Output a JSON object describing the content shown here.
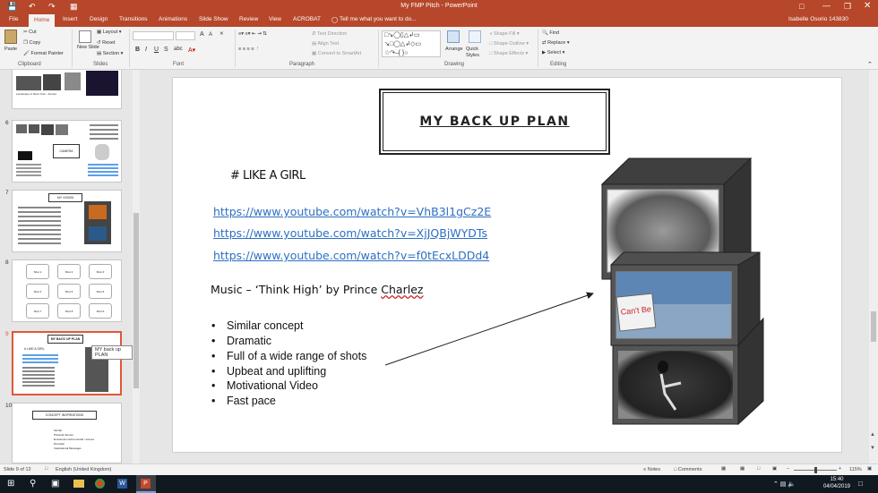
{
  "window": {
    "title": "My FMP Pitch - PowerPoint",
    "user": "Isabelle Osorio 143830"
  },
  "tabs": [
    "File",
    "Home",
    "Insert",
    "Design",
    "Transitions",
    "Animations",
    "Slide Show",
    "Review",
    "View",
    "ACROBAT"
  ],
  "tell_me": "Tell me what you want to do...",
  "ribbon": {
    "clipboard": {
      "group": "Clipboard",
      "paste": "Paste",
      "cut": "Cut",
      "copy": "Copy",
      "format_painter": "Format Painter"
    },
    "slides": {
      "group": "Slides",
      "new_slide": "New Slide",
      "layout": "Layout",
      "reset": "Reset",
      "section": "Section"
    },
    "font": {
      "group": "Font",
      "bold": "B",
      "italic": "I",
      "underline": "U",
      "strike": "S",
      "shadow": "abc",
      "grow": "A",
      "shrink": "A"
    },
    "paragraph": {
      "group": "Paragraph",
      "text_direction": "Text Direction",
      "align_text": "Align Text",
      "smartart": "Convert to SmartArt"
    },
    "drawing": {
      "group": "Drawing",
      "arrange": "Arrange",
      "quick_styles": "Quick Styles",
      "shape_fill": "Shape Fill",
      "shape_outline": "Shape Outline",
      "shape_effects": "Shape Effects"
    },
    "editing": {
      "group": "Editing",
      "find": "Find",
      "replace": "Replace",
      "select": "Select"
    }
  },
  "thumbnails": {
    "numbers": [
      "6",
      "7",
      "8",
      "9",
      "10"
    ],
    "t5_caption": "Landscape of Moon Kiss - Sunset",
    "t6_box": "CAMERA",
    "t7_box": "MY VISION",
    "t8_cells": [
      "Shot 1",
      "Shot 2",
      "Shot 3",
      "Shot 4",
      "Shot 5",
      "Shot 6",
      "Shot 7",
      "Shot 8",
      "Shot 9"
    ],
    "t9_title": "MY BACK UP PLAN",
    "t9_text": "# LIKE A GIRL",
    "t10_title": "CONCEPT INSPIRATIONS",
    "t10_bullets": [
      "Similar",
      "Physical themes",
      "Emotional environmental / scenes",
      "Dramatic",
      "Inspirational Messages"
    ],
    "tooltip": "MY back up PLAN"
  },
  "slide": {
    "title": "MY BACK UP PLAN",
    "hashtag": "# LIKE A GIRL",
    "links": [
      "https://www.youtube.com/watch?v=VhB3l1gCz2E",
      "https://www.youtube.com/watch?v=XjJQBjWYDTs",
      "https://www.youtube.com/watch?v=f0tEcxLDDd4"
    ],
    "music": "Music – ‘Think High’ by Prince ",
    "music_name": "Charlez",
    "bullets": [
      "Similar concept",
      "Dramatic",
      "Full of a wide range of shots",
      "Upbeat and uplifting",
      "Motivational Video",
      "Fast pace"
    ],
    "sign_text": "Can't Be"
  },
  "status": {
    "slide": "Slide 9 of 12",
    "language": "English (United Kingdom)",
    "notes": "Notes",
    "comments": "Comments",
    "zoom": "115%"
  },
  "taskbar": {
    "time": "15:40",
    "date": "04/04/2019"
  },
  "colors": {
    "accent": "#b7472a",
    "link": "#2d6fc4",
    "selection": "#e0573a"
  }
}
